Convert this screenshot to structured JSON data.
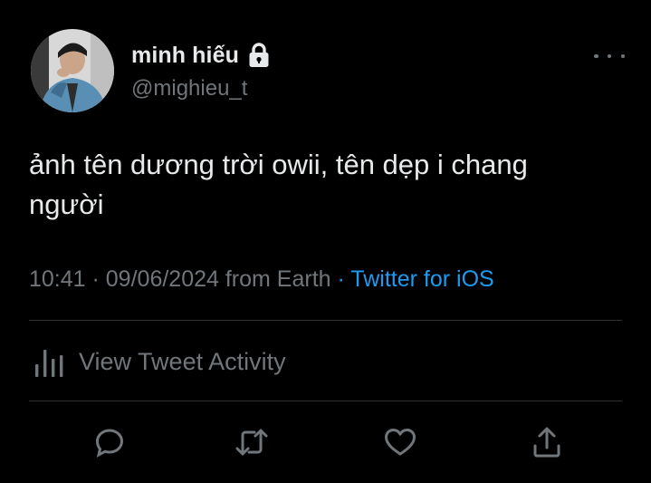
{
  "author": {
    "display_name": "minh hiếu",
    "handle": "@mighieu_t",
    "protected": true,
    "icons": {
      "avatar": "profile-photo",
      "lock": "lock-icon",
      "more": "more-options-icon"
    }
  },
  "tweet": {
    "text_line1": "ảnh tên dương trời owii, tên dẹp i chang",
    "text_line2": "người",
    "time": "10:41",
    "separator1": " · ",
    "date": "09/06/2024",
    "location": " from Earth",
    "separator2": " · ",
    "source": "Twitter for iOS"
  },
  "activity": {
    "label": "View Tweet Activity",
    "icon": "analytics-bars-icon"
  },
  "actions": [
    {
      "name": "reply",
      "icon": "reply-icon"
    },
    {
      "name": "retweet",
      "icon": "retweet-icon"
    },
    {
      "name": "like",
      "icon": "heart-icon"
    },
    {
      "name": "share",
      "icon": "share-icon"
    }
  ],
  "colors": {
    "background": "#000000",
    "primary_text": "#e7e9ea",
    "secondary_text": "#71767b",
    "link": "#1d9bf0",
    "divider": "#2f3336"
  }
}
